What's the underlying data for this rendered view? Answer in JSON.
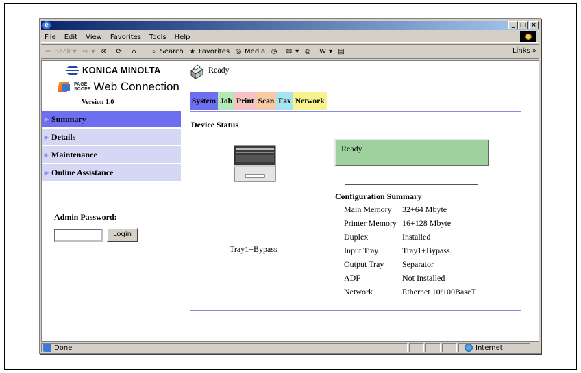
{
  "browser": {
    "menu": [
      "File",
      "Edit",
      "View",
      "Favorites",
      "Tools",
      "Help"
    ],
    "toolbar": {
      "back": "Back",
      "search": "Search",
      "favorites": "Favorites",
      "media": "Media",
      "links": "Links »"
    },
    "status": {
      "left": "Done",
      "zone": "Internet"
    }
  },
  "brand": {
    "company": "KONICA MINOLTA",
    "pagescope_top": "PAGE",
    "pagescope_bottom": "SCOPE",
    "product": "Web Connection",
    "version": "Version 1.0"
  },
  "nav": {
    "items": [
      {
        "label": "Summary",
        "active": true
      },
      {
        "label": "Details",
        "active": false
      },
      {
        "label": "Maintenance",
        "active": false
      },
      {
        "label": "Online Assistance",
        "active": false
      }
    ]
  },
  "admin": {
    "label": "Admin Password:",
    "login": "Login"
  },
  "main": {
    "status_text": "Ready",
    "tabs": [
      "System",
      "Job",
      "Print",
      "Scan",
      "Fax",
      "Network"
    ],
    "section_title": "Device Status",
    "device_status": "Ready",
    "tray_label": "Tray1+Bypass",
    "config_title": "Configuration Summary",
    "config": [
      {
        "key": "Main Memory",
        "value": "32+64 Mbyte"
      },
      {
        "key": "Printer Memory",
        "value": "16+128 Mbyte"
      },
      {
        "key": "Duplex",
        "value": "Installed"
      },
      {
        "key": "Input Tray",
        "value": "Tray1+Bypass"
      },
      {
        "key": "Output Tray",
        "value": "Separator"
      },
      {
        "key": "ADF",
        "value": "Not Installed"
      },
      {
        "key": "Network",
        "value": "Ethernet 10/100BaseT"
      }
    ]
  },
  "colors": {
    "active_nav": "#6e6ef0",
    "nav_bg": "#d6d6f5",
    "status_green": "#9fd19f"
  }
}
